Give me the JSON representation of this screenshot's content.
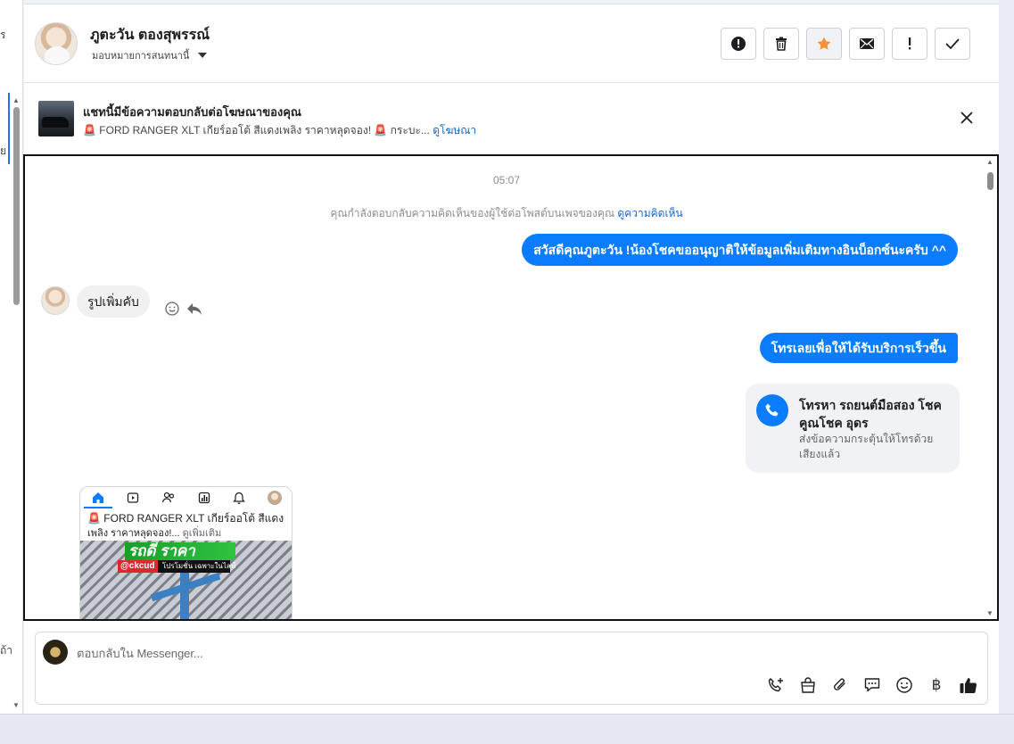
{
  "left_rail": {
    "fragment_top": "ร",
    "fragment_mid": "ย",
    "fragment_bottom": "ถ้า"
  },
  "header": {
    "contact_name": "ภูตะวัน ตองสุพรรณ์",
    "assign_label": "มอบหมายการสนทนานี้",
    "actions": [
      {
        "name": "spam",
        "icon": "alert-circle-icon"
      },
      {
        "name": "delete",
        "icon": "trash-icon"
      },
      {
        "name": "star",
        "icon": "star-icon"
      },
      {
        "name": "mark-unread",
        "icon": "envelope-icon"
      },
      {
        "name": "follow-up",
        "icon": "exclamation-icon"
      },
      {
        "name": "done",
        "icon": "checkmark-icon"
      }
    ],
    "star_color": "#f7923a"
  },
  "ad_banner": {
    "title": "แชทนี้มีข้อความตอบกลับต่อโฆษณาของคุณ",
    "subtitle": "🚨 FORD RANGER XLT เกียร์ออโต้ สีแดงเพลิง ราคาหลุดจอง! 🚨 กระบะ...",
    "view_ad_link": "ดูโฆษณา"
  },
  "conversation": {
    "timestamp": "05:07",
    "notice_text": "คุณกำลังตอบกลับความคิดเห็นของผู้ใช้ต่อโพสต์บนเพจของคุณ",
    "notice_link": "ดูความคิดเห็น",
    "messages": [
      {
        "direction": "outgoing",
        "text": "สวัสดีคุณภูตะวัน !น้องโชคขออนุญาติให้ข้อมูลเพิ่มเติมทางอินบ็อกซ์นะครับ ^^"
      },
      {
        "direction": "incoming",
        "text": "รูปเพิ่มคับ"
      },
      {
        "direction": "outgoing",
        "text": "โทรเลยเพื่อให้ได้รับบริการเร็วขึ้น"
      }
    ],
    "call_card": {
      "title": "โทรหา รถยนต์มือสอง โชคคูณโชค อุดร",
      "subtitle": "ส่งข้อความกระตุ้นให้โทรด้วยเสียงแล้ว"
    },
    "shared_screenshot": {
      "line1": "🚨 FORD RANGER XLT เกียร์ออโต้ สีแดง",
      "line2": "เพลิง ราคาหลุดจอง!...",
      "see_more": "ดูเพิ่มเติม",
      "sign_text": "รถดี ราคา",
      "tag_badge": "@ckcud",
      "tag_text": "โปรโมชั่น เฉพาะในไลฟ์"
    },
    "accent_color": "#0a7cff"
  },
  "composer": {
    "placeholder": "ตอบกลับใน Messenger...",
    "tools": [
      "call-plus-icon",
      "shopping-bag-icon",
      "paperclip-icon",
      "saved-reply-icon",
      "emoji-icon",
      "baht-icon",
      "thumbs-up-icon"
    ],
    "baht_symbol": "฿"
  }
}
